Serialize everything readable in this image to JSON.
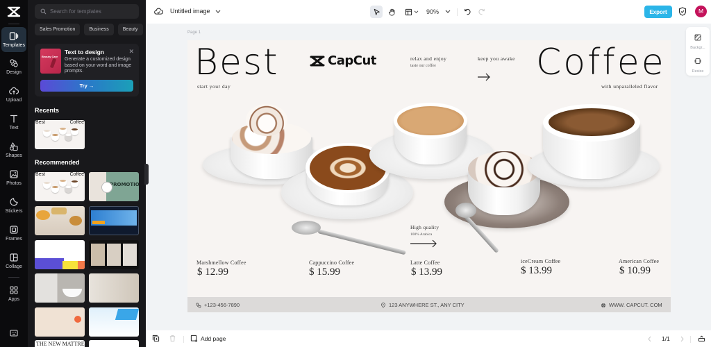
{
  "rail": {
    "items": [
      {
        "label": "Templates",
        "icon": "templates-icon",
        "active": true
      },
      {
        "label": "Design",
        "icon": "design-icon"
      },
      {
        "label": "Upload",
        "icon": "upload-icon"
      },
      {
        "label": "Text",
        "icon": "text-icon"
      },
      {
        "label": "Shapes",
        "icon": "shapes-icon"
      },
      {
        "label": "Photos",
        "icon": "photos-icon"
      },
      {
        "label": "Stickers",
        "icon": "stickers-icon"
      },
      {
        "label": "Frames",
        "icon": "frames-icon"
      },
      {
        "label": "Collage",
        "icon": "collage-icon"
      },
      {
        "label": "Apps",
        "icon": "apps-icon"
      }
    ]
  },
  "panel": {
    "search_placeholder": "Search for templates",
    "chips": [
      "Sales Promotion",
      "Business",
      "Beauty"
    ],
    "promo": {
      "title": "Text to design",
      "description": "Generate a customized design based on your word and image prompts.",
      "thumb_text": "Beauty Care",
      "try_label": "Try →"
    },
    "recents_title": "Recents",
    "recommended_title": "Recommended",
    "template_thumb_texts": {
      "left": "Best",
      "right": "Coffee",
      "promotion": "PROMOTION",
      "mattress": "THE NEW MATTRESS"
    }
  },
  "topbar": {
    "doc_title": "Untitled image",
    "zoom": "90%",
    "export_label": "Export",
    "avatar_initial": "M"
  },
  "canvas": {
    "page_label": "Page 1",
    "side_tools": [
      {
        "label": "Backgr...",
        "icon": "background-icon"
      },
      {
        "label": "Resize",
        "icon": "resize-icon"
      }
    ]
  },
  "design": {
    "title_left": "Best",
    "title_right": "Coffee",
    "subtitle_left": "start your day",
    "subtitle_right": "with unparalleled flavor",
    "brand": "CapCut",
    "tag1_line1": "relax and enjoy",
    "tag1_line2": "taste our coffee",
    "tag2": "keep you awake",
    "quality_line1": "High quality",
    "quality_line2": "100% Arabica",
    "products": [
      {
        "name": "Marshmellow Coffee",
        "price": "$ 12.99"
      },
      {
        "name": "Cappuccino Coffee",
        "price": "$ 15.99"
      },
      {
        "name": "Latte Coffee",
        "price": "$ 13.99"
      },
      {
        "name": "iceCream Coffee",
        "price": "$ 13.99"
      },
      {
        "name": "American Coffee",
        "price": "$ 10.99"
      }
    ],
    "footer": {
      "phone": "+123-456-7890",
      "address": "123 ANYWHERE ST., ANY CITY",
      "website": "WWW. CAPCUT. COM"
    }
  },
  "bottombar": {
    "add_page": "Add page",
    "page_indicator": "1/1"
  }
}
